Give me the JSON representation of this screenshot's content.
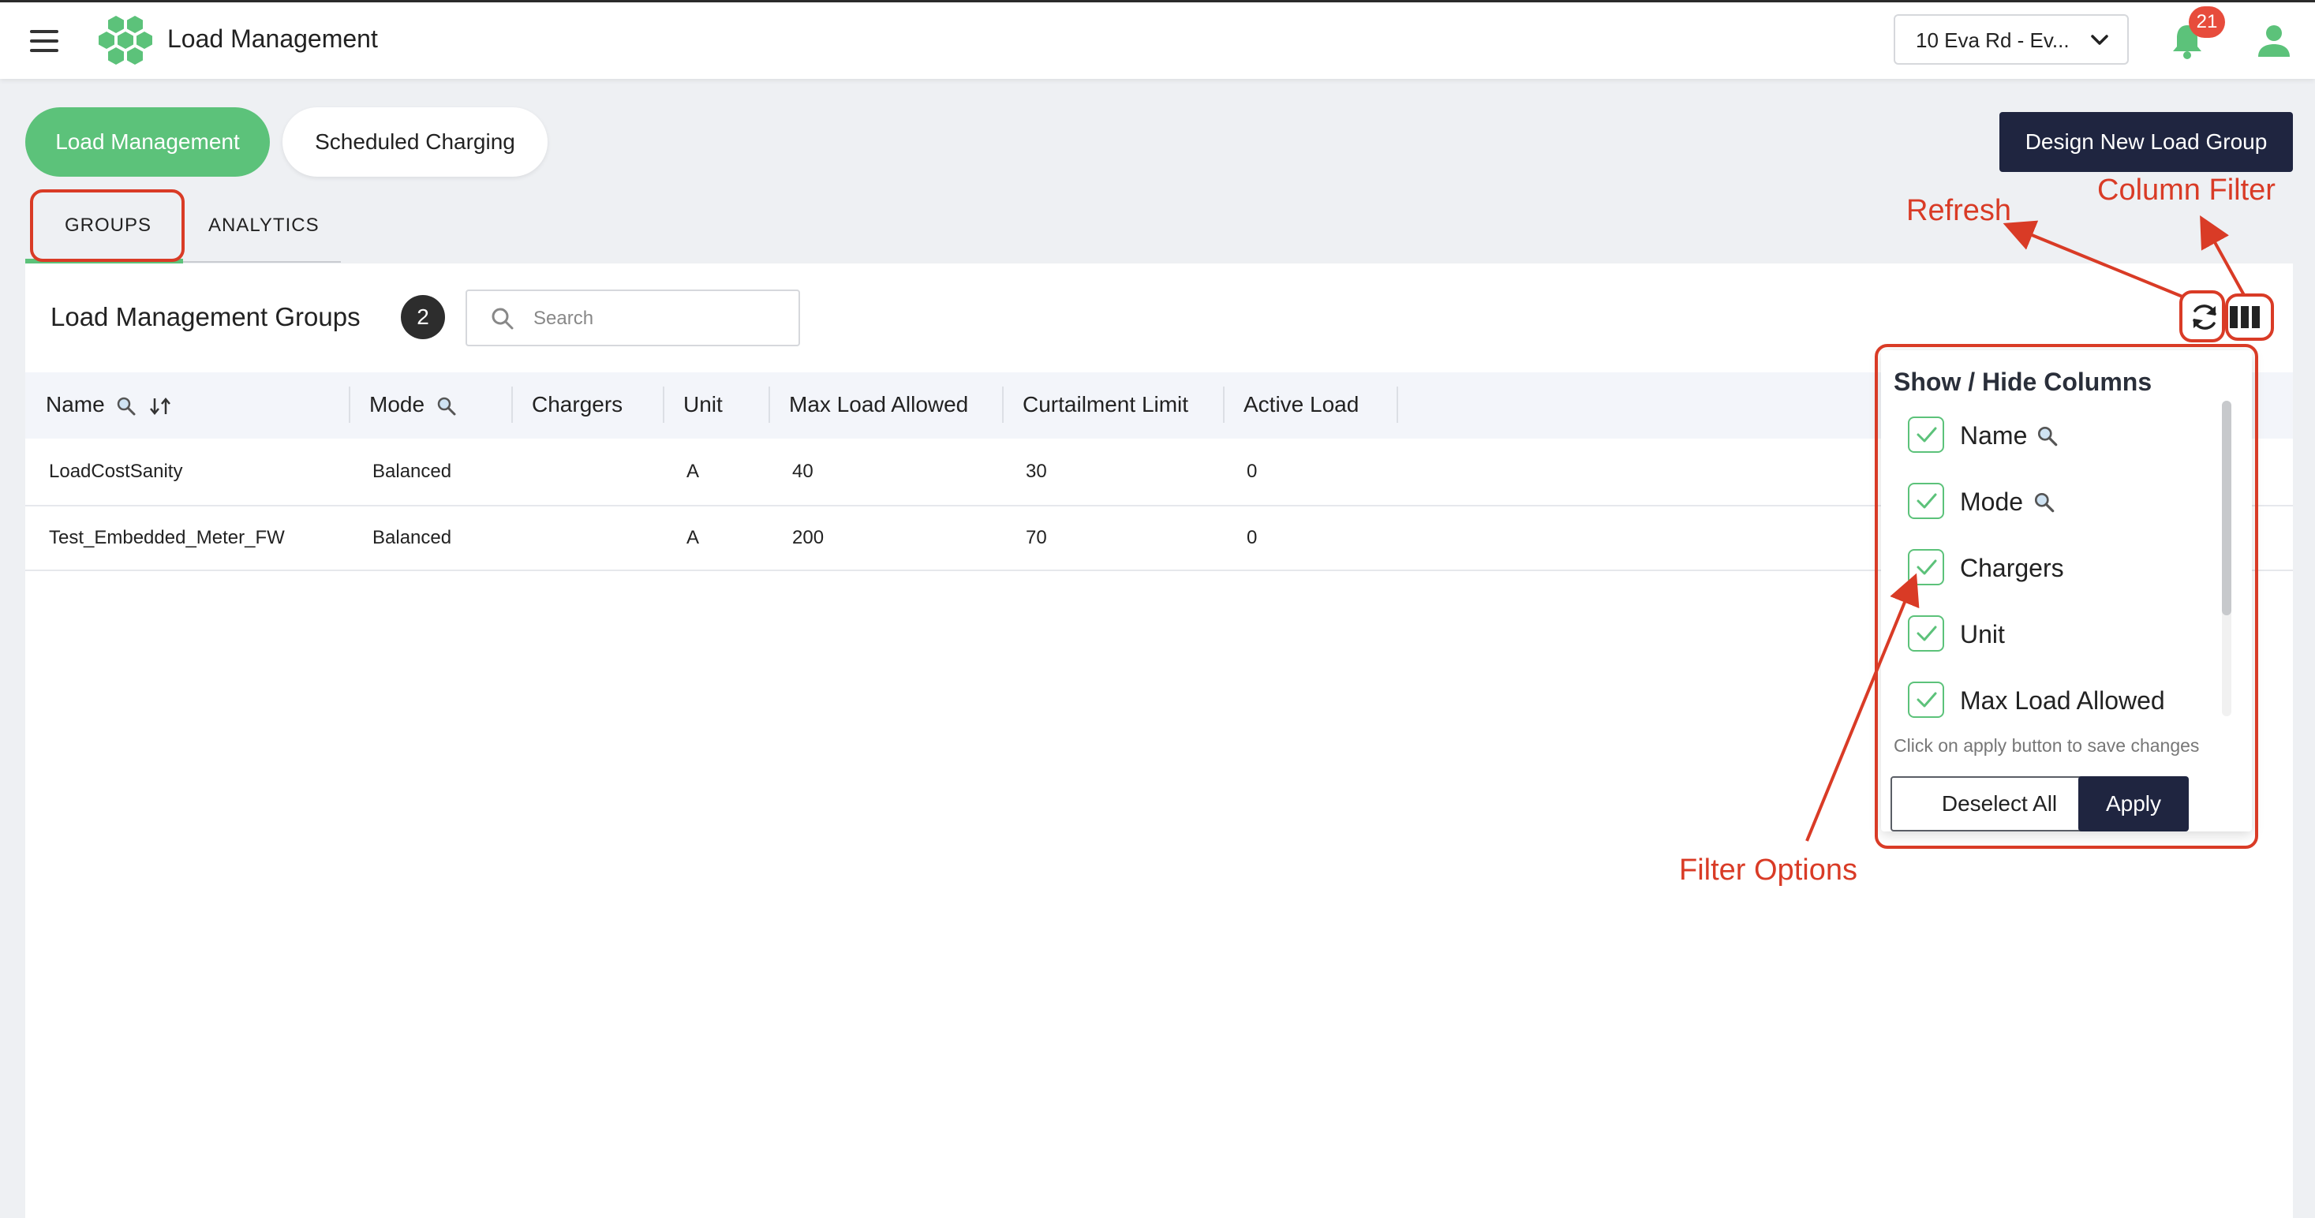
{
  "header": {
    "title": "Load Management",
    "site_selector": "10 Eva Rd - Ev...",
    "notifications_count": "21"
  },
  "mode_tabs": {
    "load_management": "Load Management",
    "scheduled_charging": "Scheduled Charging"
  },
  "design_button": "Design New Load Group",
  "sub_tabs": {
    "groups": "GROUPS",
    "analytics": "ANALYTICS"
  },
  "groups": {
    "title": "Load Management Groups",
    "count": "2",
    "search_placeholder": "Search"
  },
  "table": {
    "headers": [
      "Name",
      "Mode",
      "Chargers",
      "Unit",
      "Max Load Allowed",
      "Curtailment Limit",
      "Active Load"
    ],
    "rows": [
      [
        "LoadCostSanity",
        "Balanced",
        "",
        "A",
        "40",
        "30",
        "0"
      ],
      [
        "Test_Embedded_Meter_FW",
        "Balanced",
        "",
        "A",
        "200",
        "70",
        "0"
      ]
    ]
  },
  "column_filter": {
    "title": "Show / Hide Columns",
    "options": [
      "Name",
      "Mode",
      "Chargers",
      "Unit",
      "Max Load Allowed"
    ],
    "hint": "Click on apply button to save changes",
    "deselect_label": "Deselect All",
    "apply_label": "Apply"
  },
  "annotations": {
    "refresh": "Refresh",
    "column_filter": "Column Filter",
    "filter_options": "Filter Options",
    "color": "#d93b26"
  },
  "icons": [
    "menu-icon",
    "logo-icon",
    "chevron-down-icon",
    "bell-icon",
    "user-icon",
    "search-icon",
    "refresh-icon",
    "columns-icon",
    "check-icon",
    "sort-icon"
  ],
  "colors": {
    "accent_green": "#5cc27a",
    "navy": "#1f2540",
    "badge_red": "#e74c3c"
  }
}
